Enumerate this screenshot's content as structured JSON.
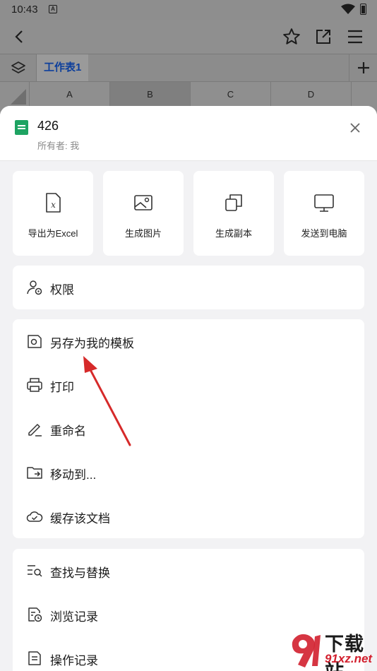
{
  "status_bar": {
    "time": "10:43",
    "notification_icon": "A"
  },
  "sheet_tabs": {
    "active_tab": "工作表1"
  },
  "columns": [
    "A",
    "B",
    "C",
    "D"
  ],
  "file": {
    "name": "426",
    "owner": "所有者: 我"
  },
  "actions": [
    {
      "label": "导出为Excel",
      "icon": "excel-icon"
    },
    {
      "label": "生成图片",
      "icon": "image-icon"
    },
    {
      "label": "生成副本",
      "icon": "copy-icon"
    },
    {
      "label": "发送到电脑",
      "icon": "monitor-icon"
    }
  ],
  "permission": {
    "label": "权限"
  },
  "menu_group_1": [
    {
      "label": "另存为我的模板"
    },
    {
      "label": "打印"
    },
    {
      "label": "重命名"
    },
    {
      "label": "移动到..."
    },
    {
      "label": "缓存该文档"
    }
  ],
  "menu_group_2": [
    {
      "label": "查找与替换"
    },
    {
      "label": "浏览记录"
    },
    {
      "label": "操作记录"
    }
  ],
  "watermark": {
    "brand": "下载站",
    "domain": "91xz.net"
  },
  "colors": {
    "accent": "#1ea362",
    "annotation_arrow": "#d62a2a"
  }
}
